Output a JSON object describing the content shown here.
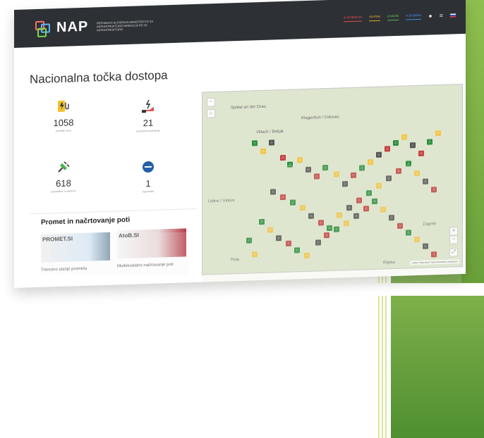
{
  "brand": {
    "title": "NAP",
    "subtitle": "REPUBLIKA SLOVENIJA MINISTRSTVO ZA INFRASTRUKTURO DIREKCIJA RS ZA INFRASTRUKTURO"
  },
  "nav": {
    "items": [
      {
        "label": "e-mobilnost",
        "color": "#e34b4b"
      },
      {
        "label": "storitve",
        "color": "#e5a826"
      },
      {
        "label": "podatki",
        "color": "#59b84d"
      },
      {
        "label": "o projektu",
        "color": "#3e8edc"
      }
    ],
    "user_icon": "user-icon",
    "menu_icon": "menu-icon",
    "language_icon": "flag-icon"
  },
  "page": {
    "title": "Nacionalna točka dostopa"
  },
  "stats": [
    {
      "value": "1058",
      "label": "polnilnih mest",
      "icon": "charger-icon"
    },
    {
      "value": "21",
      "label": "ponudnikov polnjenja",
      "icon": "hand-charge-icon"
    },
    {
      "value": "618",
      "label": "ponudnikov e-sistemov",
      "icon": "plug-icon"
    },
    {
      "value": "1",
      "label": "tuja mesta",
      "icon": "round-icon"
    }
  ],
  "promet": {
    "title": "Promet in načrtovanje poti",
    "cards": [
      {
        "name": "PROMET.SI",
        "caption": "Trenutno stanje prometa"
      },
      {
        "name": "AtoB.SI",
        "caption": "Multimodalno načrtovanje poti"
      }
    ]
  },
  "map": {
    "labels": [
      "Spittal an der Drau",
      "Villach / Beljak",
      "Klagenfurt / Celovec",
      "Udine / Videm",
      "Pula",
      "Zagreb",
      "Rijeka"
    ],
    "attribution": "Leaflet | Map data © OpenStreetMap contributors",
    "zoom_in": "+",
    "zoom_out": "−",
    "fullscreen": "⤢"
  },
  "colors": {
    "topbar": "#2d3035",
    "green": "#2f8f40",
    "yellow": "#f3c64b",
    "red": "#c44343",
    "gray": "#555555"
  }
}
